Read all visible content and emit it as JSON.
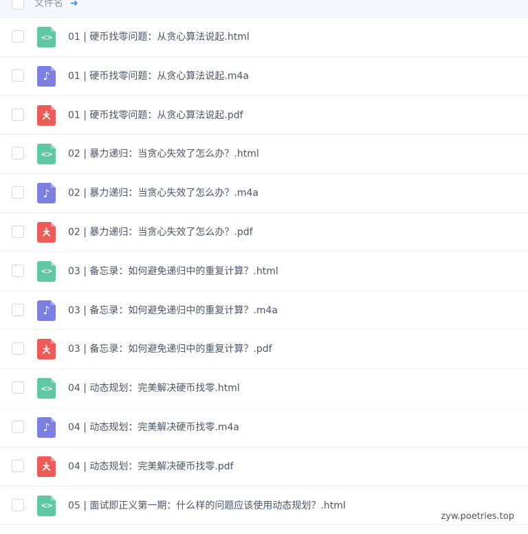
{
  "header": {
    "label": "文件名",
    "sort_icon": "sort-up-icon"
  },
  "files": [
    {
      "name": "01 | 硬币找零问题：从贪心算法说起.html",
      "type": "html"
    },
    {
      "name": "01 | 硬币找零问题：从贪心算法说起.m4a",
      "type": "m4a"
    },
    {
      "name": "01 | 硬币找零问题：从贪心算法说起.pdf",
      "type": "pdf"
    },
    {
      "name": "02 | 暴力递归：当贪心失效了怎么办？.html",
      "type": "html"
    },
    {
      "name": "02 | 暴力递归：当贪心失效了怎么办？.m4a",
      "type": "m4a"
    },
    {
      "name": "02 | 暴力递归：当贪心失效了怎么办？.pdf",
      "type": "pdf"
    },
    {
      "name": "03 | 备忘录：如何避免递归中的重复计算？.html",
      "type": "html"
    },
    {
      "name": "03 | 备忘录：如何避免递归中的重复计算？.m4a",
      "type": "m4a"
    },
    {
      "name": "03 | 备忘录：如何避免递归中的重复计算？.pdf",
      "type": "pdf"
    },
    {
      "name": "04 | 动态规划：完美解决硬币找零.html",
      "type": "html"
    },
    {
      "name": "04 | 动态规划：完美解决硬币找零.m4a",
      "type": "m4a"
    },
    {
      "name": "04 | 动态规划：完美解决硬币找零.pdf",
      "type": "pdf"
    },
    {
      "name": "05 | 面试即正义第一期：什么样的问题应该使用动态规划？.html",
      "type": "html"
    }
  ],
  "icon_names": {
    "html": "code-file-icon",
    "m4a": "audio-file-icon",
    "pdf": "pdf-file-icon"
  },
  "colors": {
    "html": "#5fc8a2",
    "m4a": "#7b7fe0",
    "pdf": "#ec5b56"
  },
  "watermark": "zyw.poetries.top"
}
